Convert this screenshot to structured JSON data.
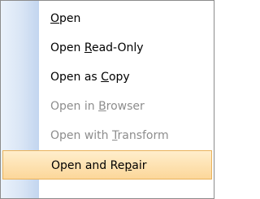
{
  "menu": {
    "items": [
      {
        "before": "",
        "key": "O",
        "after": "pen",
        "enabled": true,
        "highlighted": false
      },
      {
        "before": "Open ",
        "key": "R",
        "after": "ead-Only",
        "enabled": true,
        "highlighted": false
      },
      {
        "before": "Open as ",
        "key": "C",
        "after": "opy",
        "enabled": true,
        "highlighted": false
      },
      {
        "before": "Open in ",
        "key": "B",
        "after": "rowser",
        "enabled": false,
        "highlighted": false
      },
      {
        "before": "Open with ",
        "key": "T",
        "after": "ransform",
        "enabled": false,
        "highlighted": false
      },
      {
        "before": "Open and Re",
        "key": "p",
        "after": "air",
        "enabled": true,
        "highlighted": true
      }
    ]
  },
  "colors": {
    "highlight_fill": "#fcd79a",
    "highlight_border": "#e9b25b",
    "disabled_text": "#8d8d8d",
    "gutter": "#d9e5f5"
  }
}
